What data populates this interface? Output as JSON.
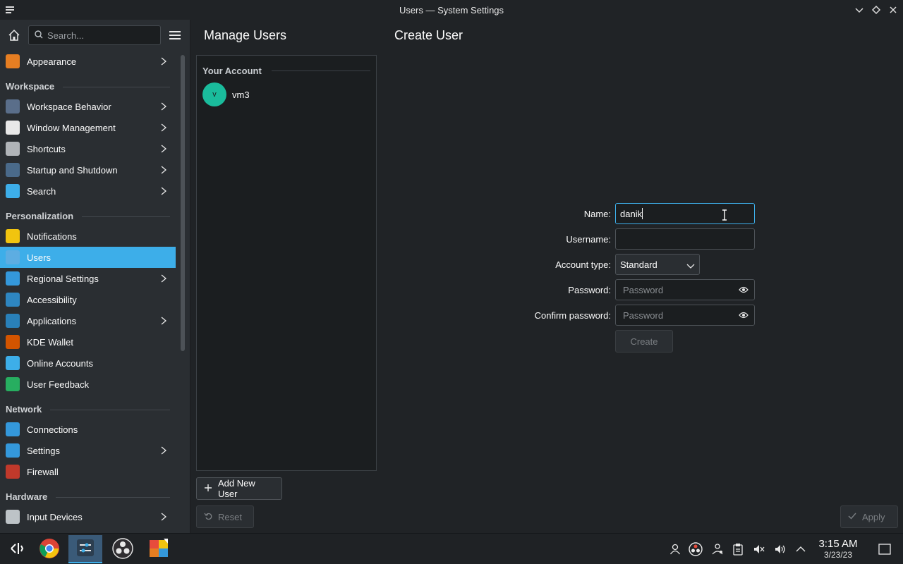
{
  "window": {
    "title": "Users — System Settings"
  },
  "sidebar": {
    "search_placeholder": "Search...",
    "entries": [
      {
        "type": "item",
        "label": "Appearance",
        "chevron": true,
        "color": "#e67e22"
      },
      {
        "type": "section",
        "label": "Workspace"
      },
      {
        "type": "item",
        "label": "Workspace Behavior",
        "chevron": true,
        "color": "#5a6e8a"
      },
      {
        "type": "item",
        "label": "Window Management",
        "chevron": true,
        "color": "#e8e8e8"
      },
      {
        "type": "item",
        "label": "Shortcuts",
        "chevron": true,
        "color": "#b0b4b8"
      },
      {
        "type": "item",
        "label": "Startup and Shutdown",
        "chevron": true,
        "color": "#4a6a8a"
      },
      {
        "type": "item",
        "label": "Search",
        "chevron": true,
        "color": "#3daee9"
      },
      {
        "type": "section",
        "label": "Personalization"
      },
      {
        "type": "item",
        "label": "Notifications",
        "chevron": false,
        "color": "#f1c40f"
      },
      {
        "type": "item",
        "label": "Users",
        "chevron": false,
        "color": "#5dade2",
        "active": true
      },
      {
        "type": "item",
        "label": "Regional Settings",
        "chevron": true,
        "color": "#3498db"
      },
      {
        "type": "item",
        "label": "Accessibility",
        "chevron": false,
        "color": "#2e86c1"
      },
      {
        "type": "item",
        "label": "Applications",
        "chevron": true,
        "color": "#2980b9"
      },
      {
        "type": "item",
        "label": "KDE Wallet",
        "chevron": false,
        "color": "#d35400"
      },
      {
        "type": "item",
        "label": "Online Accounts",
        "chevron": false,
        "color": "#3daee9"
      },
      {
        "type": "item",
        "label": "User Feedback",
        "chevron": false,
        "color": "#27ae60"
      },
      {
        "type": "section",
        "label": "Network"
      },
      {
        "type": "item",
        "label": "Connections",
        "chevron": false,
        "color": "#3498db"
      },
      {
        "type": "item",
        "label": "Settings",
        "chevron": true,
        "color": "#3498db"
      },
      {
        "type": "item",
        "label": "Firewall",
        "chevron": false,
        "color": "#c0392b"
      },
      {
        "type": "section",
        "label": "Hardware"
      },
      {
        "type": "item",
        "label": "Input Devices",
        "chevron": true,
        "color": "#bdc3c7"
      }
    ]
  },
  "main": {
    "list_title": "Manage Users",
    "page_title": "Create User",
    "your_account_label": "Your Account",
    "current_user": {
      "name": "vm3",
      "initial": "v"
    },
    "add_user_label": "Add New User",
    "reset_label": "Reset",
    "apply_label": "Apply"
  },
  "form": {
    "name_label": "Name:",
    "name_value": "danik",
    "username_label": "Username:",
    "username_value": "",
    "account_type_label": "Account type:",
    "account_type_value": "Standard",
    "password_label": "Password:",
    "password_placeholder": "Password",
    "confirm_label": "Confirm password:",
    "confirm_placeholder": "Password",
    "create_label": "Create"
  },
  "taskbar": {
    "time": "3:15 AM",
    "date": "3/23/23"
  }
}
